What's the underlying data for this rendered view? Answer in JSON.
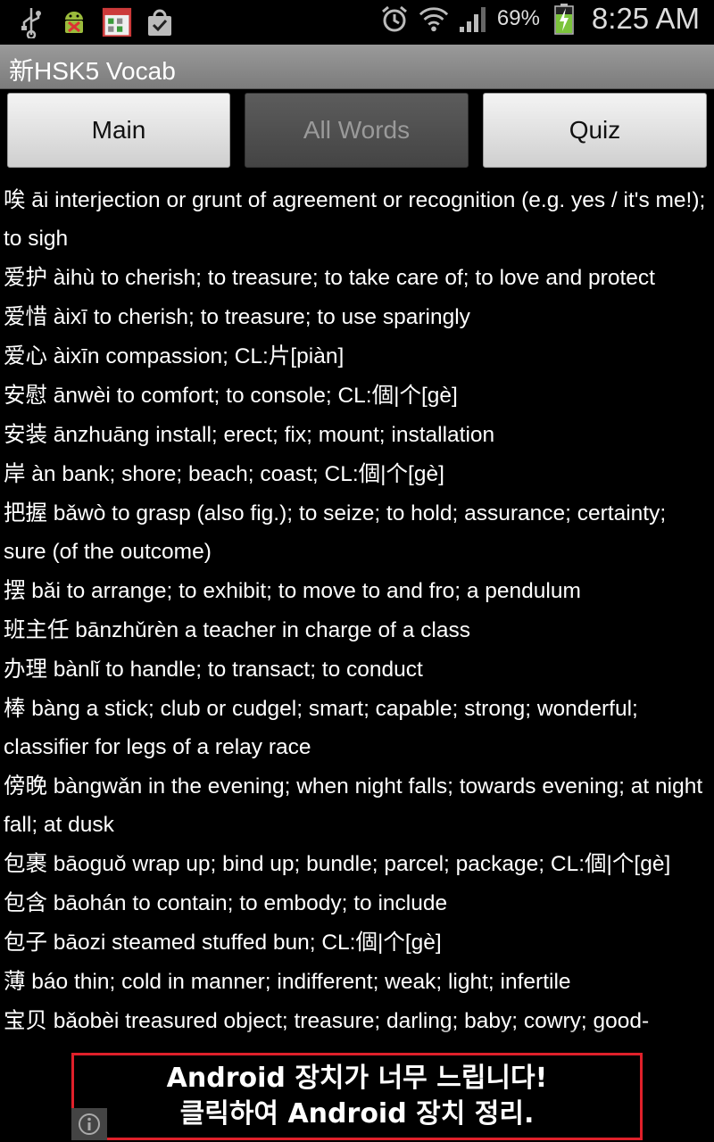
{
  "status_bar": {
    "battery_percent": "69%",
    "time": "8:25 AM",
    "icons": [
      "usb-icon",
      "android-debug-icon",
      "app-grid-icon",
      "shopping-bag-icon",
      "alarm-icon",
      "wifi-icon",
      "signal-icon",
      "battery-charging-icon"
    ]
  },
  "app": {
    "title": "新HSK5 Vocab"
  },
  "tabs": [
    {
      "label": "Main",
      "active": false
    },
    {
      "label": "All Words",
      "active": true
    },
    {
      "label": "Quiz",
      "active": false
    }
  ],
  "entries": [
    {
      "hanzi": "唉",
      "text": " āi interjection or grunt of agreement or recognition (e.g. yes / it's me!); to sigh"
    },
    {
      "hanzi": "爱护",
      "text": " àihù to cherish; to treasure; to take care of; to love and protect"
    },
    {
      "hanzi": "爱惜",
      "text": " àixī to cherish; to treasure; to use sparingly"
    },
    {
      "hanzi": "爱心",
      "text": " àixīn compassion; CL:片[piàn]"
    },
    {
      "hanzi": "安慰",
      "text": " ānwèi to comfort; to console; CL:個|个[gè]"
    },
    {
      "hanzi": "安装",
      "text": " ānzhuāng install; erect; fix; mount; installation"
    },
    {
      "hanzi": "岸",
      "text": " àn bank; shore; beach; coast; CL:個|个[gè]"
    },
    {
      "hanzi": "把握",
      "text": " bǎwò to grasp (also fig.); to seize; to hold; assurance; certainty; sure (of the outcome)"
    },
    {
      "hanzi": "摆",
      "text": " bǎi to arrange; to exhibit; to move to and fro; a pendulum"
    },
    {
      "hanzi": "班主任",
      "text": " bānzhǔrèn a teacher in charge of a class"
    },
    {
      "hanzi": "办理",
      "text": " bànlǐ to handle; to transact; to conduct"
    },
    {
      "hanzi": "棒",
      "text": " bàng a stick; club or cudgel; smart; capable; strong; wonderful; classifier for legs of a relay race"
    },
    {
      "hanzi": "傍晚",
      "text": " bàngwǎn in the evening; when night falls; towards evening; at night fall; at dusk"
    },
    {
      "hanzi": "包裹",
      "text": " bāoguǒ wrap up; bind up; bundle; parcel; package; CL:個|个[gè]"
    },
    {
      "hanzi": "包含",
      "text": " bāohán to contain; to embody; to include"
    },
    {
      "hanzi": "包子",
      "text": " bāozi steamed stuffed bun; CL:個|个[gè]"
    },
    {
      "hanzi": "薄",
      "text": " báo thin; cold in manner; indifferent; weak; light; infertile"
    },
    {
      "hanzi": "宝贝",
      "text": " bǎobèi treasured object; treasure; darling; baby; cowry; good-"
    }
  ],
  "ad": {
    "line1": "Android 장치가 너무 느립니다!",
    "line2": "클릭하여 Android 장치 정리."
  }
}
